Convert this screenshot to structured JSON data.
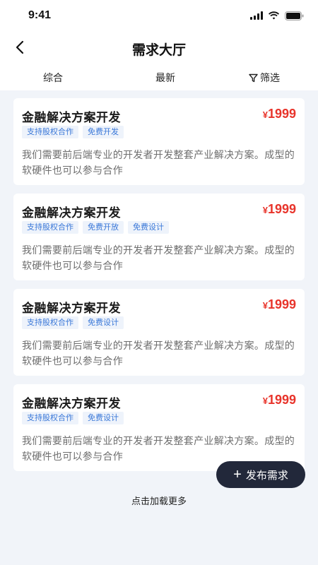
{
  "status_bar": {
    "time": "9:41",
    "icons": [
      "signal-icon",
      "wifi-icon",
      "battery-icon"
    ]
  },
  "nav": {
    "title": "需求大厅",
    "back_icon": "chevron-left-icon"
  },
  "tabs": [
    {
      "label": "综合"
    },
    {
      "label": "最新"
    },
    {
      "label": "筛选",
      "icon": "filter-icon"
    }
  ],
  "cards": [
    {
      "title": "金融解决方案开发",
      "currency": "¥",
      "price": "1999",
      "tags": [
        "支持股权合作",
        "免费开发"
      ],
      "description": "我们需要前后端专业的开发者开发整套产业解决方案。成型的软硬件也可以参与合作"
    },
    {
      "title": "金融解决方案开发",
      "currency": "¥",
      "price": "1999",
      "tags": [
        "支持股权合作",
        "免费开放",
        "免费设计"
      ],
      "description": "我们需要前后端专业的开发者开发整套产业解决方案。成型的软硬件也可以参与合作"
    },
    {
      "title": "金融解决方案开发",
      "currency": "¥",
      "price": "1999",
      "tags": [
        "支持股权合作",
        "免费设计"
      ],
      "description": "我们需要前后端专业的开发者开发整套产业解决方案。成型的软硬件也可以参与合作"
    },
    {
      "title": "金融解决方案开发",
      "currency": "¥",
      "price": "1999",
      "tags": [
        "支持股权合作",
        "免费设计"
      ],
      "description": "我们需要前后端专业的开发者开发整套产业解决方案。成型的软硬件也可以参与合作"
    }
  ],
  "publish_button": {
    "plus": "+",
    "label": "发布需求"
  },
  "load_more": "点击加载更多",
  "colors": {
    "price": "#e8342b",
    "tag_text": "#3a78d8",
    "tag_bg": "#eef3fb",
    "publish_bg": "#22283a",
    "page_bg": "#f1f4f9"
  }
}
